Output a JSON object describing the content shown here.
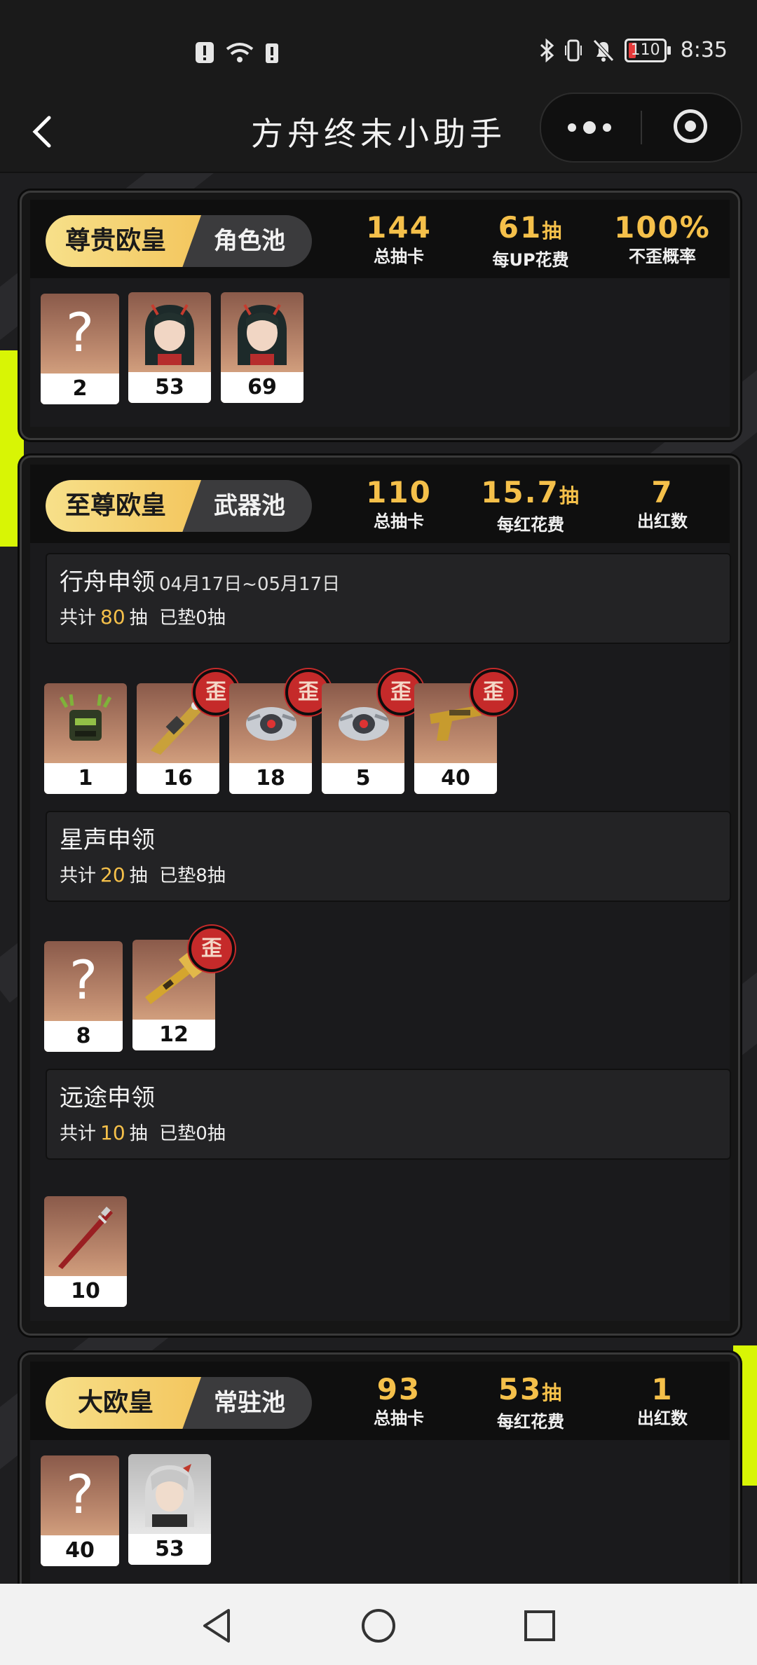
{
  "status_bar": {
    "battery": "110",
    "time": "8:35"
  },
  "nav": {
    "title": "方舟终末小助手"
  },
  "cards": [
    {
      "rank": "尊贵欧皇",
      "pool": "角色池",
      "stats": [
        {
          "value": "144",
          "unit": "",
          "label": "总抽卡"
        },
        {
          "value": "61",
          "unit": "抽",
          "label": "每UP花费"
        },
        {
          "value": "100%",
          "unit": "",
          "label": "不歪概率"
        }
      ],
      "items": [
        {
          "count": "2",
          "type": "unknown"
        },
        {
          "count": "53",
          "type": "character"
        },
        {
          "count": "69",
          "type": "character"
        }
      ]
    },
    {
      "rank": "至尊欧皇",
      "pool": "武器池",
      "stats": [
        {
          "value": "110",
          "unit": "",
          "label": "总抽卡"
        },
        {
          "value": "15.7",
          "unit": "抽",
          "label": "每红花费"
        },
        {
          "value": "7",
          "unit": "",
          "label": "出红数"
        }
      ],
      "banners": [
        {
          "name": "行舟申领",
          "date": "04月17日~05月17日",
          "total_prefix": "共计",
          "total": "80",
          "total_suffix": "抽",
          "pity": "已垫0抽",
          "items": [
            {
              "count": "1",
              "wai": false
            },
            {
              "count": "16",
              "wai": true
            },
            {
              "count": "18",
              "wai": true
            },
            {
              "count": "5",
              "wai": true
            },
            {
              "count": "40",
              "wai": true
            }
          ]
        },
        {
          "name": "星声申领",
          "total_prefix": "共计",
          "total": "20",
          "total_suffix": "抽",
          "pity": "已垫8抽",
          "items": [
            {
              "count": "8",
              "wai": false
            },
            {
              "count": "12",
              "wai": true
            }
          ]
        },
        {
          "name": "远途申领",
          "total_prefix": "共计",
          "total": "10",
          "total_suffix": "抽",
          "pity": "已垫0抽",
          "items": [
            {
              "count": "10",
              "wai": false
            }
          ]
        }
      ],
      "wai_label": "歪"
    },
    {
      "rank": "大欧皇",
      "pool": "常驻池",
      "stats": [
        {
          "value": "93",
          "unit": "",
          "label": "总抽卡"
        },
        {
          "value": "53",
          "unit": "抽",
          "label": "每红花费"
        },
        {
          "value": "1",
          "unit": "",
          "label": "出红数"
        }
      ],
      "items": [
        {
          "count": "40",
          "type": "unknown"
        },
        {
          "count": "53",
          "type": "character"
        }
      ]
    }
  ],
  "unknown_glyph": "?",
  "colors": {
    "gold": "#f5c04a",
    "badge_gold": "#f3c65e",
    "wai_red": "#c52a2a",
    "lime": "#d8f505"
  }
}
